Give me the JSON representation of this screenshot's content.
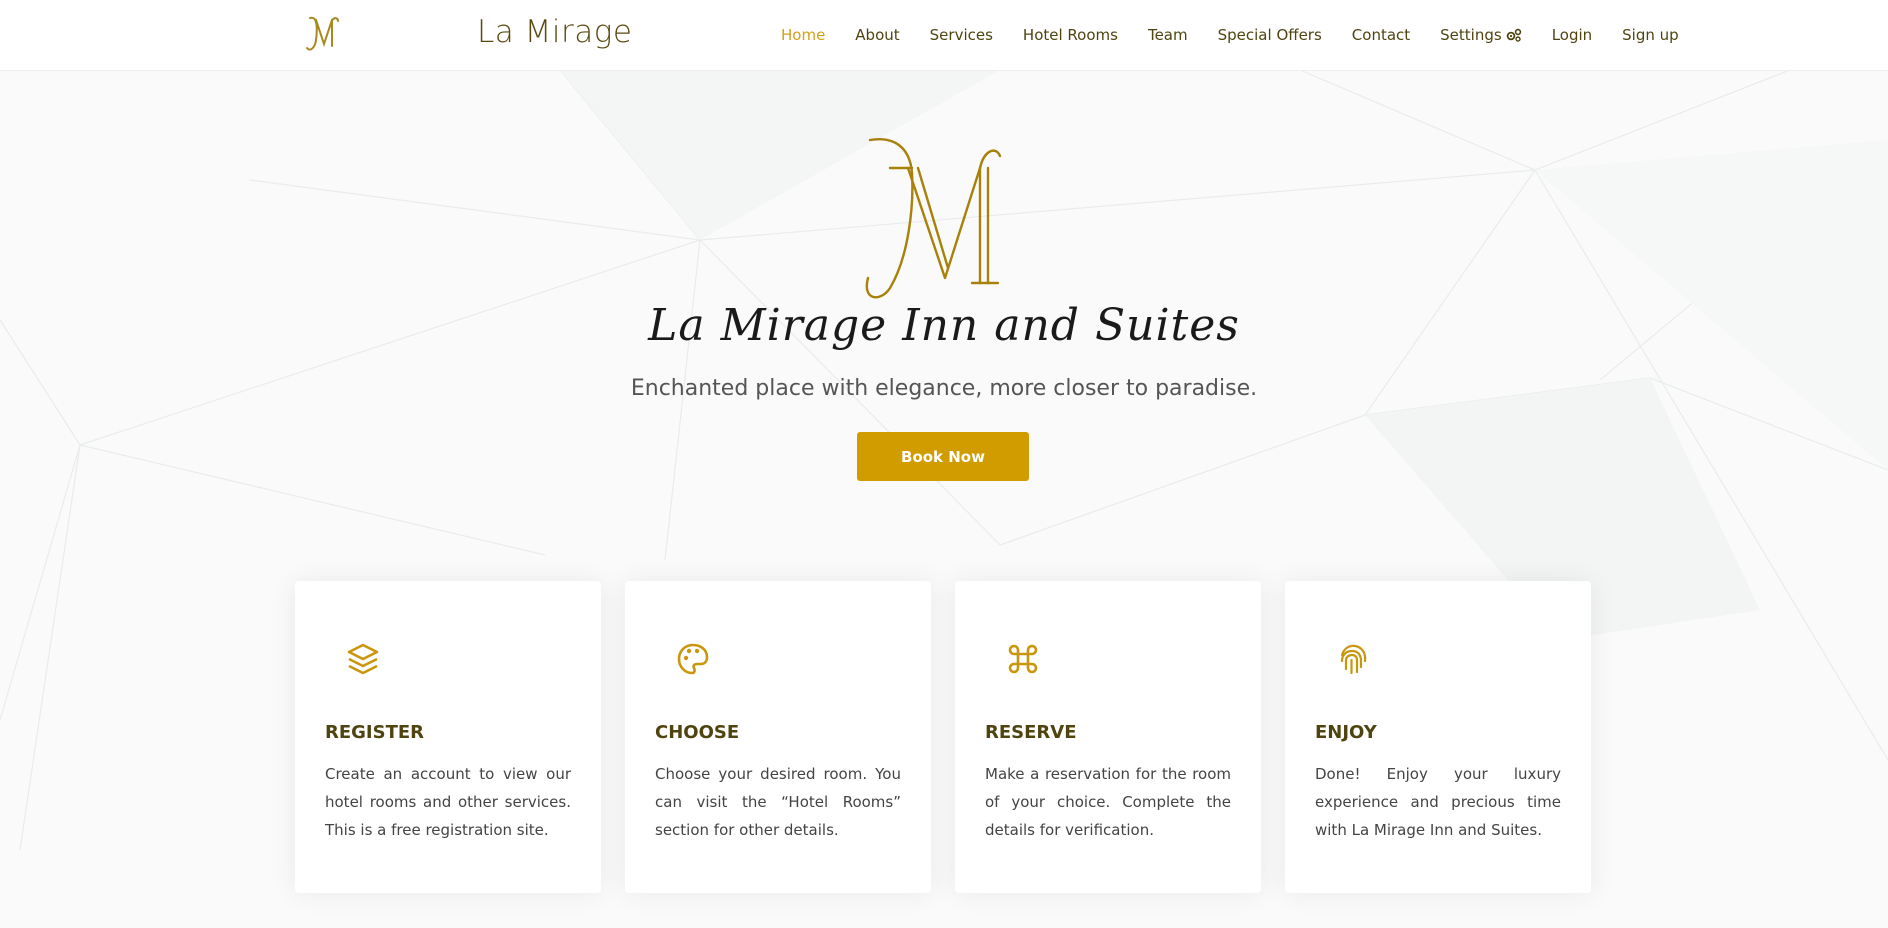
{
  "header": {
    "brand_name": "La Mirage",
    "nav": [
      {
        "label": "Home",
        "active": true
      },
      {
        "label": "About"
      },
      {
        "label": "Services"
      },
      {
        "label": "Hotel Rooms"
      },
      {
        "label": "Team"
      },
      {
        "label": "Special Offers"
      },
      {
        "label": "Contact"
      },
      {
        "label": "Settings",
        "icon": "gears-icon"
      },
      {
        "label": "Login"
      },
      {
        "label": "Sign up"
      }
    ]
  },
  "hero": {
    "logo_icon": "monogram-m-logo",
    "title": "La Mirage Inn and Suites",
    "tagline": "Enchanted place with elegance, more closer to paradise.",
    "cta_label": "Book Now"
  },
  "features": [
    {
      "icon": "layers-icon",
      "title": "REGISTER",
      "text": "Create an account to view our hotel rooms and other services. This is a free registration site."
    },
    {
      "icon": "palette-icon",
      "title": "CHOOSE",
      "text": "Choose your desired room. You can visit the “Hotel Rooms” section for other details."
    },
    {
      "icon": "command-icon",
      "title": "RESERVE",
      "text": "Make a reservation for the room of your choice. Complete the details for verification."
    },
    {
      "icon": "fingerprint-icon",
      "title": "ENJOY",
      "text": "Done! Enjoy your luxury experience and precious time with La Mirage Inn and Suites."
    }
  ],
  "colors": {
    "accent": "#d19c00",
    "active_nav": "#d4a017",
    "heading": "#4f4410",
    "icon": "#c9960c"
  }
}
